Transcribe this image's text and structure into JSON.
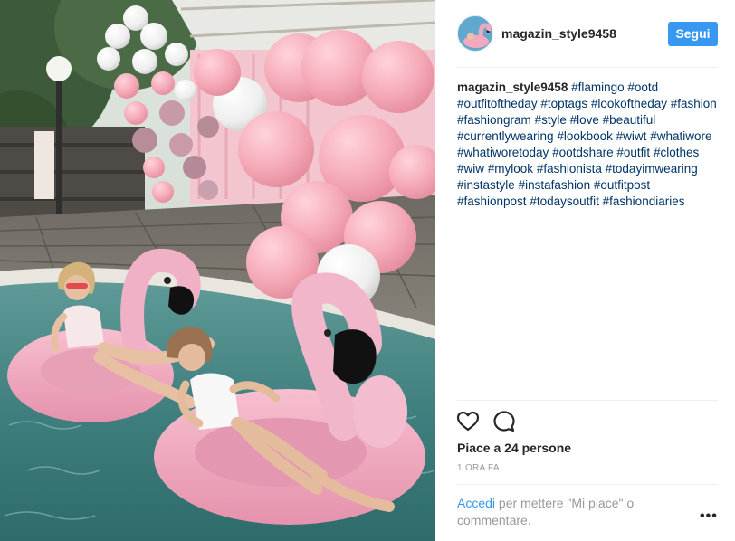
{
  "post": {
    "image_description_icon": "post-photo",
    "author": {
      "username": "magazin_style9458",
      "avatar_icon": "flamingo-avatar"
    },
    "follow_label": "Segui",
    "caption": {
      "username": "magazin_style9458",
      "hashtags": [
        "#flamingo",
        "#ootd",
        "#outfitoftheday",
        "#toptags",
        "#lookoftheday",
        "#fashion",
        "#fashiongram",
        "#style",
        "#love",
        "#beautiful",
        "#currentlywearing",
        "#lookbook",
        "#wiwt",
        "#whatiwore",
        "#whatiworetoday",
        "#ootdshare",
        "#outfit",
        "#clothes",
        "#wiw",
        "#mylook",
        "#fashionista",
        "#todayimwearing",
        "#instastyle",
        "#instafashion",
        "#outfitpost",
        "#fashionpost",
        "#todaysoutfit",
        "#fashiondiaries"
      ]
    },
    "actions": {
      "like_icon": "heart-icon",
      "comment_icon": "comment-icon"
    },
    "likes_text": "Piace a 24 persone",
    "timestamp": "1 ORA FA",
    "comment_prompt": {
      "link": "Accedi",
      "text": " per mettere \"Mi piace\" o commentare."
    },
    "more_label": "•••"
  },
  "colors": {
    "accent": "#3897f0",
    "hashtag": "#003569",
    "muted": "#999999"
  }
}
